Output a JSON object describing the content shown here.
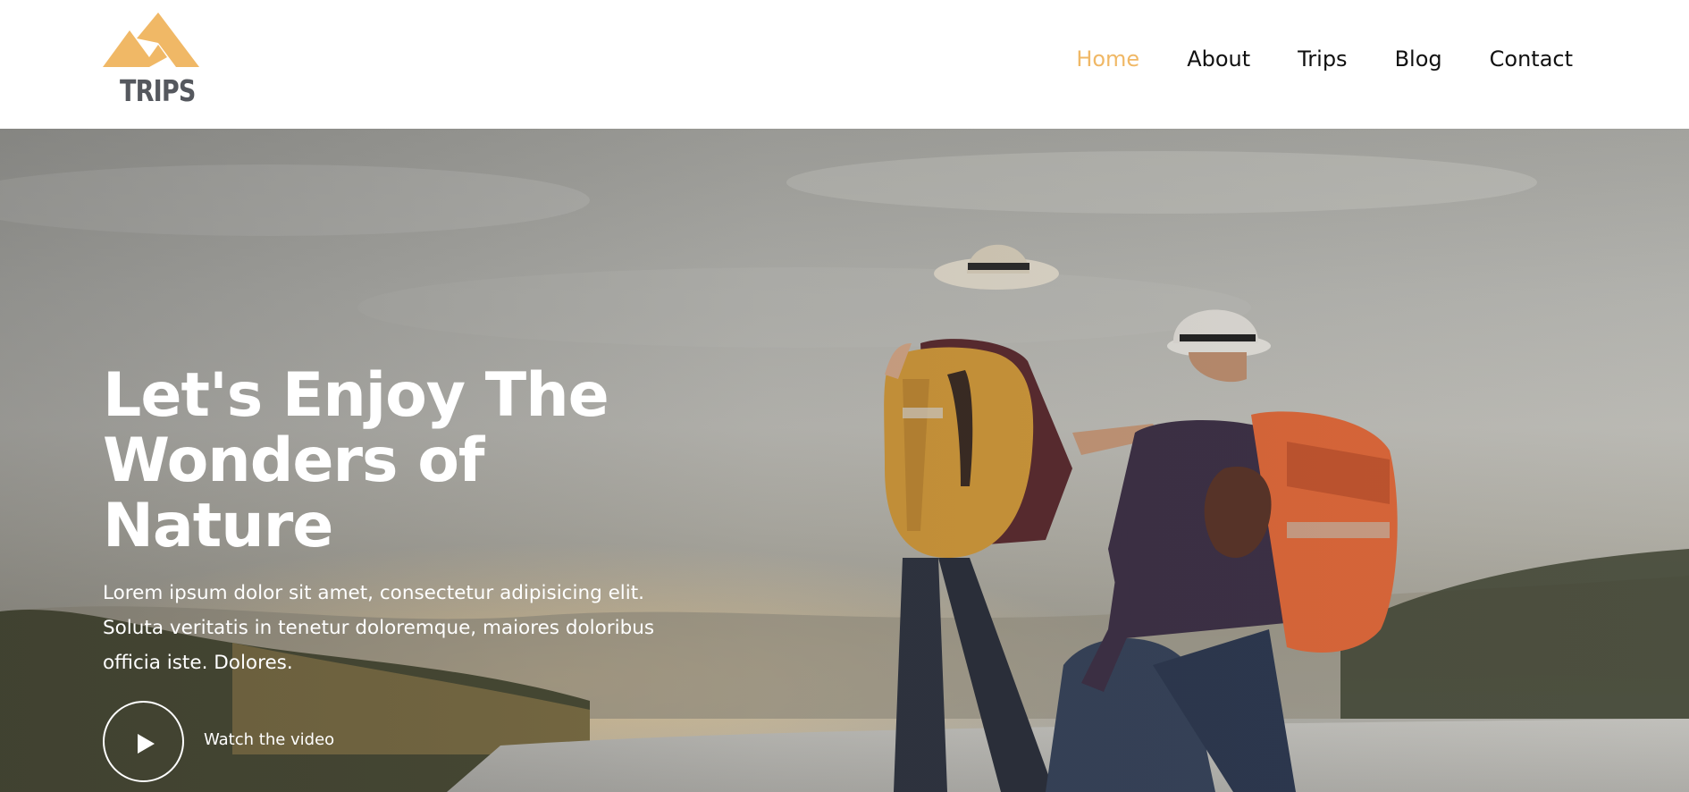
{
  "brand": {
    "name": "TRIPS",
    "logo_icon": "mountain-icon",
    "accent_color": "#f0b866"
  },
  "nav": {
    "items": [
      {
        "label": "Home",
        "active": true
      },
      {
        "label": "About",
        "active": false
      },
      {
        "label": "Trips",
        "active": false
      },
      {
        "label": "Blog",
        "active": false
      },
      {
        "label": "Contact",
        "active": false
      }
    ]
  },
  "hero": {
    "title": "Let's Enjoy The Wonders of Nature",
    "description": "Lorem ipsum dolor sit amet, consectetur adipisicing elit. Soluta veritatis in tenetur doloremque, maiores doloribus officia iste. Dolores.",
    "video_label": "Watch the video",
    "video_icon": "play-icon"
  }
}
